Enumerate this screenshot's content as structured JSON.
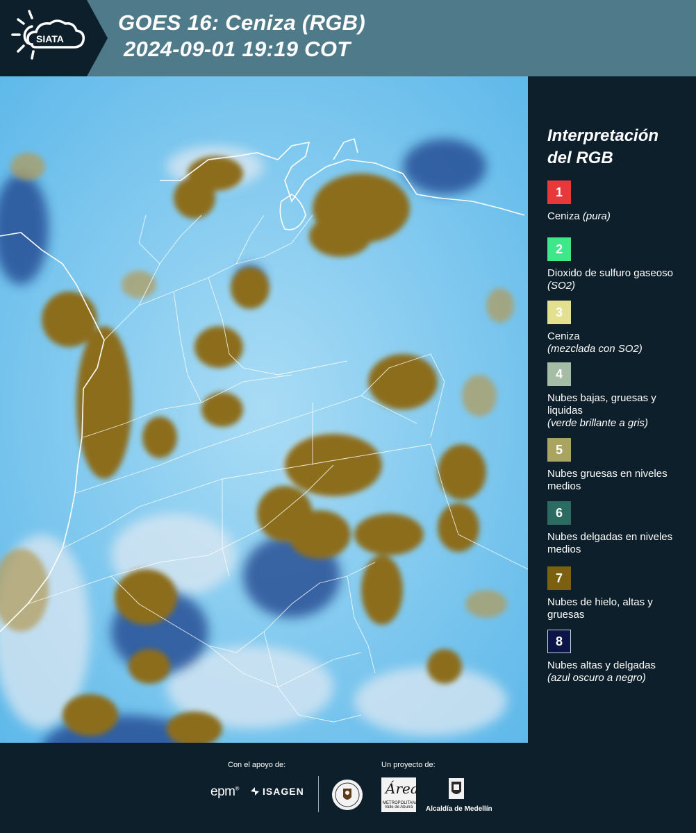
{
  "header": {
    "logo_text": "SIATA",
    "title_line1": "GOES 16: Ceniza (RGB)",
    "title_line2": "2024-09-01 19:19 COT"
  },
  "legend": {
    "title_line1": "Interpretación",
    "title_line2": "del RGB",
    "items": [
      {
        "num": "1",
        "color": "#e8383a",
        "label": "Ceniza ",
        "note": "(pura)"
      },
      {
        "num": "2",
        "color": "#3ee88a",
        "label": "Dioxido de sulfuro gaseoso ",
        "note": "(SO2)"
      },
      {
        "num": "3",
        "color": "#e3e08f",
        "label": "Ceniza",
        "note": "(mezclada con SO2)"
      },
      {
        "num": "4",
        "color": "#a6bda5",
        "label": "Nubes bajas, gruesas y liquidas",
        "note": "(verde brillante a gris)"
      },
      {
        "num": "5",
        "color": "#a9a560",
        "label": "Nubes gruesas en niveles medios",
        "note": ""
      },
      {
        "num": "6",
        "color": "#2b6b61",
        "label": "Nubes delgadas en niveles medios",
        "note": ""
      },
      {
        "num": "7",
        "color": "#7a600f",
        "label": "Nubes de hielo, altas y gruesas",
        "note": ""
      },
      {
        "num": "8",
        "color": "#0b1548",
        "label": "Nubes altas y delgadas",
        "note": "(azul oscuro a negro)"
      }
    ]
  },
  "footer": {
    "support_label": "Con el apoyo de:",
    "project_label": "Un proyecto de:",
    "epm": "epm",
    "isagen": "ISAGEN",
    "area_word": "Área",
    "area_sub": "METROPOLITANA Valle de Aburrá",
    "alcaldia": "Alcaldía de Medellín"
  }
}
